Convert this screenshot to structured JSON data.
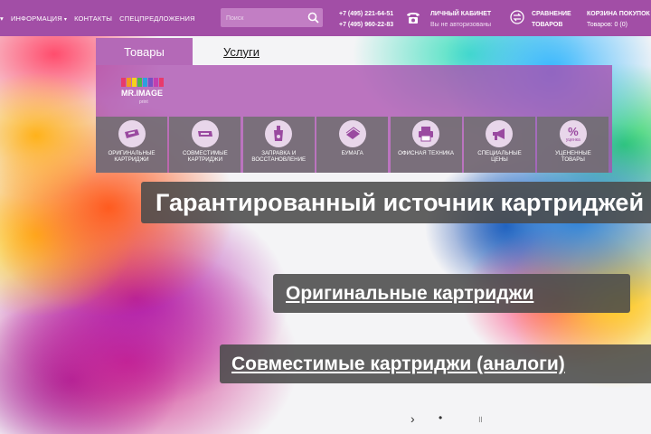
{
  "nav": {
    "items": [
      {
        "label": "ИНФОРМАЦИЯ",
        "has_dropdown": true
      },
      {
        "label": "КОНТАКТЫ",
        "has_dropdown": false
      },
      {
        "label": "СПЕЦПРЕДЛОЖЕНИЯ",
        "has_dropdown": false
      }
    ],
    "menu_arrow": "▾"
  },
  "search": {
    "placeholder": "Поиск",
    "icon": "search-icon"
  },
  "contacts": {
    "phone_1": "+7 (495) 221-64-51",
    "phone_2": "+7 (495) 960-22-83",
    "icon": "phone-icon"
  },
  "account": {
    "title": "ЛИЧНЫЙ КАБИНЕТ",
    "status": "Вы не авторизованы"
  },
  "compare": {
    "line_1": "СРАВНЕНИЕ",
    "line_2": "ТОВАРОВ",
    "icon": "compare-icon"
  },
  "cart": {
    "title": "КОРЗИНА ПОКУПОК",
    "status": "Товаров: 0 (0)"
  },
  "catalog": {
    "tabs": [
      {
        "label": "Товары",
        "active": true
      },
      {
        "label": "Услуги",
        "active": false
      }
    ],
    "brand_name": "MR.IMAGE",
    "brand_tagline": "print",
    "categories": [
      {
        "label": "ОРИГИНАЛЬНЫЕ\nКАРТРИДЖИ",
        "icon": "cartridge-icon"
      },
      {
        "label": "СОВМЕСТИМЫЕ\nКАРТРИДЖИ",
        "icon": "compatible-cartridge-icon"
      },
      {
        "label": "ЗАПРАВКА И\nВОССТАНОВЛЕНИЕ",
        "icon": "refill-icon"
      },
      {
        "label": "БУМАГА",
        "icon": "paper-icon"
      },
      {
        "label": "ОФИСНАЯ ТЕХНИКА",
        "icon": "printer-icon"
      },
      {
        "label": "СПЕЦИАЛЬНЫЕ\nЦЕНЫ",
        "icon": "megaphone-icon"
      },
      {
        "label": "УЦЕНЕННЫЕ\nТОВАРЫ",
        "icon": "discount-icon",
        "badge": "%",
        "badge_text": "уценка"
      }
    ]
  },
  "slider": {
    "headline": "Гарантированный источник картриджей",
    "link_1": "Оригинальные картриджи",
    "link_2": "Совместимые картриджи (аналоги)",
    "controls": {
      "next": "›",
      "play": "•",
      "pause": "॥"
    }
  },
  "colors": {
    "brand_purple": "#a24ea6",
    "panel_purple": "#b469b7",
    "banner_gray": "#4b4b4b"
  }
}
